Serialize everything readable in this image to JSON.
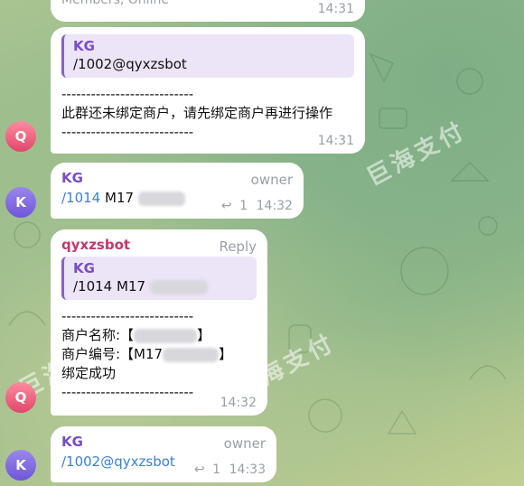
{
  "top_partial": {
    "text": "Members, Online",
    "time": "14:31"
  },
  "watermark": "巨海支付",
  "messages": [
    {
      "quote_name": "KG",
      "quote_text": "/1002@qyxzsbot",
      "lines": [
        "---------------------------",
        "此群还未绑定商户，请先绑定商户再进行操作",
        "---------------------------"
      ],
      "time": "14:31",
      "avatar": "Q"
    },
    {
      "sender": "KG",
      "role": "owner",
      "link": "/1014",
      "text": "M17",
      "replies": "1",
      "time": "14:32",
      "avatar": "K"
    },
    {
      "sender": "qyxzsbot",
      "role": "Reply",
      "quote_name": "KG",
      "quote_text": "/1014 M17",
      "lines": [
        "---------------------------",
        "商户名称:【",
        "】",
        "商户编号:【M17",
        "】",
        "绑定成功",
        "---------------------------"
      ],
      "time": "14:32",
      "avatar": "Q"
    },
    {
      "sender": "KG",
      "role": "owner",
      "link": "/1002@qyxzsbot",
      "replies": "1",
      "time": "14:33",
      "avatar": "K"
    }
  ],
  "colors": {
    "sender_kg": "#7a4cc4",
    "sender_bot": "#c2376f",
    "link": "#3a7fd8"
  }
}
